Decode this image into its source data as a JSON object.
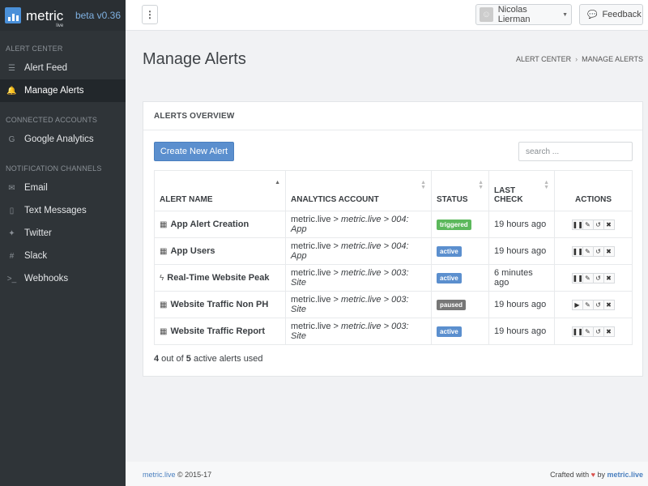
{
  "brand": {
    "name": "metric",
    "sub": "live",
    "version": "beta v0.36"
  },
  "sidebar": {
    "sections": [
      {
        "title": "ALERT CENTER",
        "items": [
          {
            "label": "Alert Feed",
            "icon": "list-icon",
            "glyph": "☰",
            "active": false
          },
          {
            "label": "Manage Alerts",
            "icon": "bell-icon",
            "glyph": "🔔",
            "active": true
          }
        ]
      },
      {
        "title": "CONNECTED ACCOUNTS",
        "items": [
          {
            "label": "Google Analytics",
            "icon": "google-icon",
            "glyph": "G",
            "active": false
          }
        ]
      },
      {
        "title": "NOTIFICATION CHANNELS",
        "items": [
          {
            "label": "Email",
            "icon": "email-icon",
            "glyph": "✉",
            "active": false
          },
          {
            "label": "Text Messages",
            "icon": "phone-icon",
            "glyph": "▯",
            "active": false
          },
          {
            "label": "Twitter",
            "icon": "twitter-icon",
            "glyph": "✦",
            "active": false
          },
          {
            "label": "Slack",
            "icon": "slack-icon",
            "glyph": "#",
            "active": false
          },
          {
            "label": "Webhooks",
            "icon": "terminal-icon",
            "glyph": ">_",
            "active": false
          }
        ]
      }
    ]
  },
  "topbar": {
    "menu_glyph": "⋮",
    "user_name": "Nicolas Lierman",
    "feedback_label": "Feedback"
  },
  "page": {
    "title": "Manage Alerts",
    "breadcrumb": [
      "ALERT CENTER",
      "MANAGE ALERTS"
    ]
  },
  "panel": {
    "heading": "ALERTS OVERVIEW",
    "create_label": "Create New Alert",
    "search_placeholder": "search ...",
    "columns": [
      "ALERT NAME",
      "ANALYTICS ACCOUNT",
      "STATUS",
      "LAST\nCHECK",
      "ACTIONS"
    ],
    "rows": [
      {
        "icon": "calendar-icon",
        "glyph": "▦",
        "name": "App Alert Creation",
        "account_plain": "metric.live > ",
        "account_italic": "metric.live > 004: App",
        "status": "triggered",
        "status_color": "#5cb85c",
        "last_check": "19 hours ago",
        "first_action": "pause",
        "first_action_glyph": "❚❚"
      },
      {
        "icon": "calendar-icon",
        "glyph": "▦",
        "name": "App Users",
        "account_plain": "metric.live > ",
        "account_italic": "metric.live > 004: App",
        "status": "active",
        "status_color": "#5b8fce",
        "last_check": "19 hours ago",
        "first_action": "pause",
        "first_action_glyph": "❚❚"
      },
      {
        "icon": "bolt-icon",
        "glyph": "ϟ",
        "name": "Real-Time Website Peak",
        "account_plain": "metric.live > ",
        "account_italic": "metric.live > 003: Site",
        "status": "active",
        "status_color": "#5b8fce",
        "last_check": "6 minutes ago",
        "first_action": "pause",
        "first_action_glyph": "❚❚"
      },
      {
        "icon": "calendar-icon",
        "glyph": "▦",
        "name": "Website Traffic Non PH",
        "account_plain": "metric.live > ",
        "account_italic": "metric.live > 003: Site",
        "status": "paused",
        "status_color": "#777777",
        "last_check": "19 hours ago",
        "first_action": "play",
        "first_action_glyph": "▶"
      },
      {
        "icon": "calendar-icon",
        "glyph": "▦",
        "name": "Website Traffic Report",
        "account_plain": "metric.live > ",
        "account_italic": "metric.live > 003: Site",
        "status": "active",
        "status_color": "#5b8fce",
        "last_check": "19 hours ago",
        "first_action": "pause",
        "first_action_glyph": "❚❚"
      }
    ],
    "usage": {
      "used": "4",
      "mid": " out of ",
      "total": "5",
      "suffix": " active alerts used"
    }
  },
  "footer": {
    "left_link": "metric.live",
    "left_text": " © 2015-17",
    "right_prefix": "Crafted with ",
    "heart": "♥",
    "right_by": " by ",
    "right_link": "metric.live"
  }
}
